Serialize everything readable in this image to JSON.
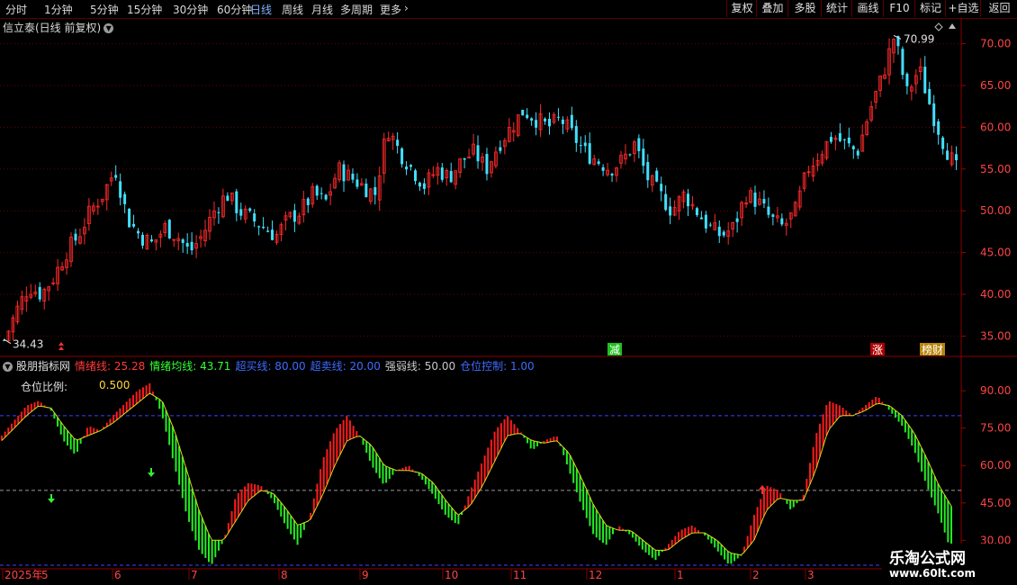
{
  "toolbar": {
    "periods": [
      "分时",
      "1分钟",
      "5分钟",
      "15分钟",
      "30分钟",
      "60分钟",
      "日线",
      "周线",
      "月线",
      "多周期",
      "更多"
    ],
    "active_period": "日线",
    "buttons": [
      "复权",
      "叠加",
      "多股",
      "统计",
      "画线",
      "F10",
      "标记",
      "+自选",
      "返回"
    ]
  },
  "stock": {
    "title": "信立泰(日线 前复权)"
  },
  "price_pane": {
    "ticks": [
      "70.00",
      "65.00",
      "60.00",
      "55.00",
      "50.00",
      "45.00",
      "40.00",
      "35.00"
    ],
    "high_label": "70.99",
    "low_label": "34.43",
    "markers": [
      "减",
      "涨",
      "榜财"
    ]
  },
  "indicator": {
    "name": "股朋指标网",
    "fields": [
      {
        "label": "情绪线:",
        "value": "25.28",
        "color": "#ff3b3b"
      },
      {
        "label": "情绪均线:",
        "value": "43.71",
        "color": "#33ff33"
      },
      {
        "label": "超买线:",
        "value": "80.00",
        "color": "#3f6bff"
      },
      {
        "label": "超卖线:",
        "value": "20.00",
        "color": "#3f6bff"
      },
      {
        "label": "强弱线:",
        "value": "50.00",
        "color": "#c8c8c8"
      },
      {
        "label": "仓位控制:",
        "value": "1.00",
        "color": "#3f6bff"
      }
    ],
    "position_label": "仓位比例:",
    "position_value": "0.500",
    "ticks": [
      "90.00",
      "75.00",
      "60.00",
      "45.00",
      "30.00"
    ]
  },
  "date_axis": {
    "labels": [
      "2025年",
      "5",
      "6",
      "7",
      "8",
      "9",
      "10",
      "11",
      "12",
      "1",
      "2",
      "3"
    ]
  },
  "watermark": {
    "line1": "乐淘公式网",
    "line2": "www.60lt.com"
  },
  "colors": {
    "up": "#ff2a2a",
    "down": "#40e0ff",
    "emotion_up": "#ff1a1a",
    "emotion_down": "#22ee22",
    "grid": "#6a0000",
    "ref_blue": "#3f3fff"
  },
  "chart_data": {
    "type": "line",
    "price": {
      "x_start": "2025-04",
      "ylim": [
        33,
        72
      ],
      "high": 70.99,
      "low": 34.43,
      "trend": [
        34.43,
        38,
        41,
        40,
        42,
        45,
        47,
        50,
        52,
        55,
        49,
        47,
        46,
        48,
        47,
        45,
        47,
        50,
        52,
        50,
        49,
        48,
        47,
        49,
        50,
        52,
        51,
        55,
        54,
        53,
        52,
        60,
        57,
        55,
        53,
        55,
        54,
        56,
        57,
        55,
        58,
        60,
        62,
        61,
        60,
        61,
        59,
        57,
        56,
        55,
        56,
        58,
        54,
        52,
        50,
        52,
        50,
        48,
        47,
        48,
        52,
        51,
        49,
        48,
        50,
        55,
        57,
        59,
        58,
        57,
        62,
        66,
        70.99,
        64,
        67,
        62,
        58,
        55
      ]
    },
    "emotion": {
      "ylim": [
        20,
        98
      ],
      "overbought": 80,
      "oversold": 20,
      "midline": 50,
      "line": [
        72,
        78,
        84,
        86,
        82,
        70,
        64,
        76,
        74,
        80,
        85,
        90,
        93,
        80,
        60,
        40,
        26,
        20,
        30,
        48,
        53,
        52,
        46,
        36,
        28,
        40,
        62,
        74,
        80,
        72,
        60,
        52,
        58,
        60,
        55,
        48,
        40,
        36,
        50,
        62,
        74,
        80,
        74,
        66,
        70,
        72,
        58,
        44,
        32,
        28,
        36,
        32,
        26,
        22,
        28,
        34,
        36,
        32,
        26,
        20,
        24,
        40,
        52,
        50,
        42,
        48,
        72,
        86,
        84,
        80,
        84,
        88,
        82,
        76,
        66,
        52,
        40,
        25.28
      ],
      "average": [
        70,
        75,
        80,
        84,
        83,
        76,
        70,
        72,
        74,
        77,
        81,
        85,
        89,
        86,
        74,
        58,
        42,
        30,
        30,
        38,
        46,
        50,
        49,
        43,
        36,
        38,
        48,
        60,
        70,
        72,
        68,
        60,
        58,
        58,
        57,
        53,
        46,
        40,
        44,
        52,
        62,
        72,
        73,
        70,
        69,
        70,
        65,
        55,
        44,
        36,
        34,
        34,
        30,
        26,
        26,
        30,
        33,
        33,
        30,
        25,
        24,
        30,
        42,
        47,
        46,
        46,
        58,
        74,
        80,
        80,
        82,
        85,
        84,
        80,
        73,
        63,
        52,
        43.71
      ]
    }
  }
}
